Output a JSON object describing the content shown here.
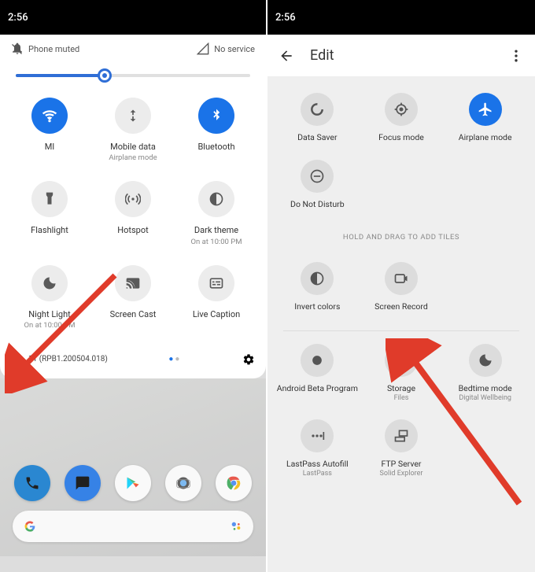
{
  "status_time": "2:56",
  "left": {
    "muted_label": "Phone muted",
    "service_label": "No service",
    "build_version": "11 (RPB1.200504.018)",
    "tiles": [
      {
        "label": "MI",
        "sub": "",
        "on": true,
        "icon": "wifi-icon"
      },
      {
        "label": "Mobile data",
        "sub": "Airplane mode",
        "on": false,
        "icon": "mobiledata-icon"
      },
      {
        "label": "Bluetooth",
        "sub": "",
        "on": true,
        "icon": "bluetooth-icon"
      },
      {
        "label": "Flashlight",
        "sub": "",
        "on": false,
        "icon": "flashlight-icon"
      },
      {
        "label": "Hotspot",
        "sub": "",
        "on": false,
        "icon": "hotspot-icon"
      },
      {
        "label": "Dark theme",
        "sub": "On at 10:00 PM",
        "on": false,
        "icon": "darktheme-icon"
      },
      {
        "label": "Night Light",
        "sub": "On at 10:00 PM",
        "on": false,
        "icon": "nightlight-icon"
      },
      {
        "label": "Screen Cast",
        "sub": "",
        "on": false,
        "icon": "cast-icon"
      },
      {
        "label": "Live Caption",
        "sub": "",
        "on": false,
        "icon": "caption-icon"
      }
    ]
  },
  "right": {
    "header_title": "Edit",
    "hold_hint": "HOLD AND DRAG TO ADD TILES",
    "active_tiles": [
      {
        "label": "Data Saver",
        "sub": "",
        "on": false,
        "icon": "datasaver-icon"
      },
      {
        "label": "Focus mode",
        "sub": "",
        "on": false,
        "icon": "focus-icon"
      },
      {
        "label": "Airplane mode",
        "sub": "",
        "on": true,
        "icon": "airplane-icon"
      },
      {
        "label": "Do Not Disturb",
        "sub": "",
        "on": false,
        "icon": "dnd-icon"
      }
    ],
    "available_tiles": [
      {
        "label": "Invert colors",
        "sub": "",
        "icon": "invert-icon"
      },
      {
        "label": "Screen Record",
        "sub": "",
        "icon": "record-icon"
      },
      {
        "label": "",
        "sub": "",
        "icon": ""
      },
      {
        "label": "Android Beta Program",
        "sub": "",
        "icon": "beta-icon"
      },
      {
        "label": "Storage",
        "sub": "Files",
        "icon": "storage-icon"
      },
      {
        "label": "Bedtime mode",
        "sub": "Digital Wellbeing",
        "icon": "bedtime-icon"
      },
      {
        "label": "LastPass Autofill",
        "sub": "LastPass",
        "icon": "lastpass-icon"
      },
      {
        "label": "FTP Server",
        "sub": "Solid Explorer",
        "icon": "ftp-icon"
      }
    ]
  }
}
